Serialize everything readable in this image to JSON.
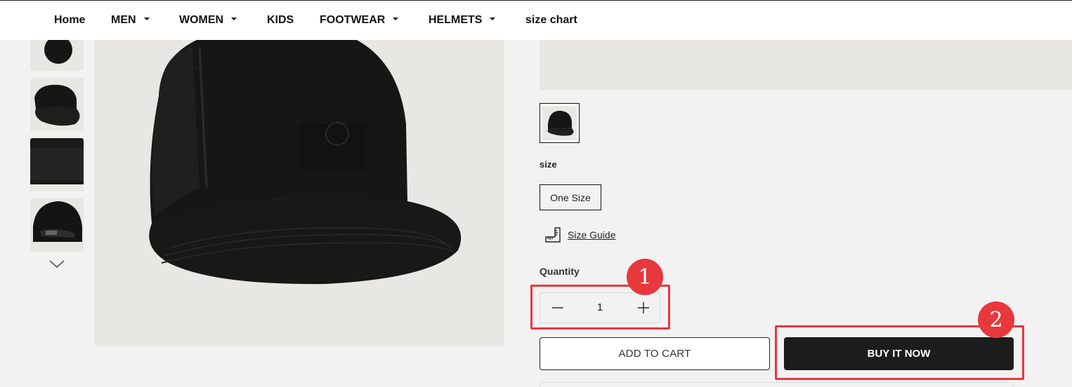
{
  "nav": {
    "items": [
      {
        "label": "Home",
        "dropdown": false
      },
      {
        "label": "MEN",
        "dropdown": true
      },
      {
        "label": "WOMEN",
        "dropdown": true
      },
      {
        "label": "KIDS",
        "dropdown": false
      },
      {
        "label": "FOOTWEAR",
        "dropdown": true
      },
      {
        "label": "HELMETS",
        "dropdown": true
      },
      {
        "label": "size chart",
        "dropdown": false
      }
    ]
  },
  "gallery": {
    "thumbnails": [
      "cap-front-thumb",
      "cap-side-thumb",
      "cap-mesh-thumb",
      "cap-back-thumb"
    ],
    "scroll_icon": "chevron-down-icon"
  },
  "product": {
    "size": {
      "label": "size",
      "options": [
        "One Size"
      ],
      "selected": "One Size"
    },
    "size_guide": {
      "label": "Size Guide",
      "icon": "ruler-icon"
    },
    "quantity": {
      "label": "Quantity",
      "value": "1"
    },
    "add_to_cart": "ADD TO CART",
    "buy_now": "BUY IT NOW"
  },
  "annotations": {
    "one": "1",
    "two": "2"
  },
  "colors": {
    "accent_red": "#e8383d",
    "buy_button": "#1c1c1e",
    "image_bg": "#e8e7e3"
  }
}
